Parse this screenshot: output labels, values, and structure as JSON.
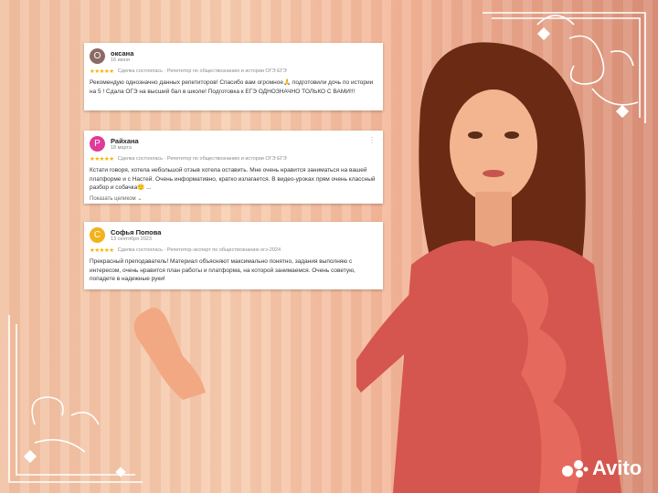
{
  "reviews": [
    {
      "initial": "О",
      "name": "оксана",
      "date": "16 июня",
      "stars": "★★★★★",
      "meta": "Сделка состоялась · Репетитор по обществознанию и истории ОГЭ ЕГЭ",
      "text": "Рекомендую однозначно данных репетиторов! Спасибо вам огромное🙏 подготовили дочь по истории на 5 ! Сдала ОГЭ на высший бал в школе! Подготовка к ЕГЭ ОДНОЗНАЧНО ТОЛЬКО С ВАМИ!!!",
      "color": "#8b6b63"
    },
    {
      "initial": "Р",
      "name": "Райхана",
      "date": "18 марта",
      "stars": "★★★★★",
      "meta": "Сделка состоялась · Репетитор по обществознанию и истории ОГЭ ЕГЭ",
      "text": "Кстати говоря, хотела небольшой отзыв хотела оставить. Мне очень нравится заниматься на вашей платформе и с Настей. Очень информативно, кратко излагается. В видео-уроках прям очень классный разбор и собачка🙂 ...",
      "more": "Показать целиком ⌄",
      "color": "#e0399a"
    },
    {
      "initial": "С",
      "name": "Софья Попова",
      "date": "13 сентября 2023",
      "stars": "★★★★★",
      "meta": "Сделка состоялась · Репетитор-эксперт по обществознанию егэ-2024",
      "text": "Прекрасный преподаватель! Материал объясняют максимально понятно, задания выполняю с интересом, очень нравится план работы и платформа, на которой занимаемся. Очень советую, попадете в надежные руки!",
      "color": "#f2b21b"
    }
  ],
  "brand": {
    "name": "Avito"
  }
}
